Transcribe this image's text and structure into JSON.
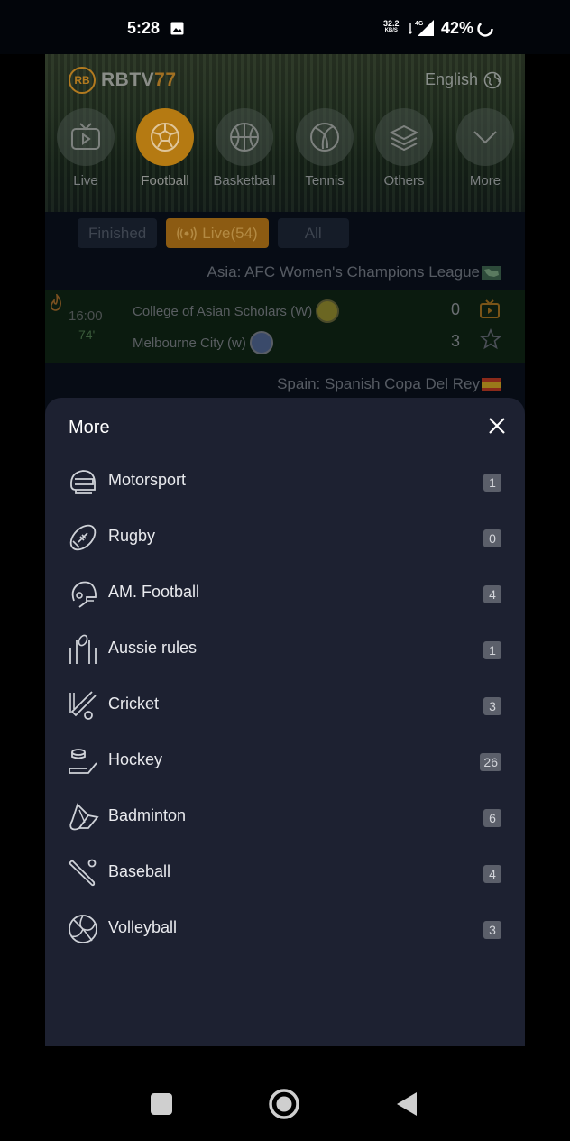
{
  "status_bar": {
    "time": "5:28",
    "speed_value": "32.2",
    "speed_unit": "KB/S",
    "network": "4G",
    "battery": "42%"
  },
  "header": {
    "brand_prefix": "RB",
    "brand_main": "RBTV",
    "brand_suffix": "77",
    "language": "English"
  },
  "categories": [
    {
      "label": "Live",
      "icon": "tv-icon"
    },
    {
      "label": "Football",
      "icon": "soccer-ball-icon",
      "active": true
    },
    {
      "label": "Basketball",
      "icon": "basketball-icon"
    },
    {
      "label": "Tennis",
      "icon": "tennis-ball-icon"
    },
    {
      "label": "Others",
      "icon": "layers-icon"
    },
    {
      "label": "More",
      "icon": "chevron-down-icon"
    }
  ],
  "filters": {
    "finished": "Finished",
    "live": "Live(54)",
    "all": "All"
  },
  "leagues": [
    {
      "name": "Asia: AFC Women's Champions League"
    },
    {
      "name": "Spain: Spanish Copa Del Rey"
    }
  ],
  "match": {
    "time": "16:00",
    "minute": "74'",
    "home": {
      "name": "College of Asian Scholars (W)",
      "score": "0"
    },
    "away": {
      "name": "Melbourne City (w)",
      "score": "3"
    }
  },
  "sheet": {
    "title": "More",
    "items": [
      {
        "name": "Motorsport",
        "count": "1",
        "icon": "helmet-icon"
      },
      {
        "name": "Rugby",
        "count": "0",
        "icon": "rugby-ball-icon"
      },
      {
        "name": "AM. Football",
        "count": "4",
        "icon": "football-helmet-icon"
      },
      {
        "name": "Aussie rules",
        "count": "1",
        "icon": "goalposts-icon"
      },
      {
        "name": "Cricket",
        "count": "3",
        "icon": "cricket-icon"
      },
      {
        "name": "Hockey",
        "count": "26",
        "icon": "hockey-icon"
      },
      {
        "name": "Badminton",
        "count": "6",
        "icon": "shuttlecock-icon"
      },
      {
        "name": "Baseball",
        "count": "4",
        "icon": "baseball-bat-icon"
      },
      {
        "name": "Volleyball",
        "count": "3",
        "icon": "volleyball-icon"
      }
    ]
  },
  "colors": {
    "accent": "#b57a12",
    "sheet_bg": "#1d2131",
    "badge_bg": "#5b5f6a"
  }
}
